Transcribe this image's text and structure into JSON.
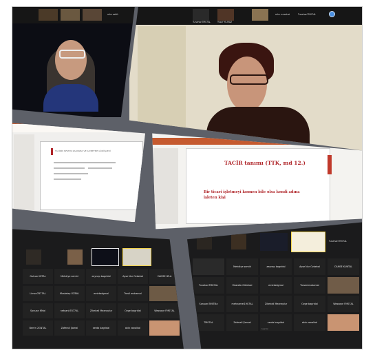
{
  "top_strip_left": {
    "labels": [
      "mhs sahih"
    ]
  },
  "top_strip_right": {
    "labels": [
      "TunahanTM07AL",
      "Yusuf YILMAZ",
      "mhs curoshai",
      "TunahanTM07AL"
    ]
  },
  "slide_right": {
    "title": "TACİR tanımı (TTK, md 12.)",
    "body": "Bir ticari işletmeyi kısmen bile olsa kendi adına işleten kişi"
  },
  "slide_left": {
    "heading": "TACİRİN SIFATINI KAZANMA VE KAYBETME GÖRÜŞLERİ"
  },
  "grid_left": {
    "rows": [
      [
        "Gulcan KETAL",
        "Mehdiye semiri",
        "zeynep bagridal",
        "Ayse Nur Ozbekal",
        "CAMSE IZLA"
      ],
      [
        "Limon7877AL",
        "Mustelep OZBAL",
        "emirtadgmal",
        "Trasil mokamal",
        ""
      ],
      [
        "Sonuan KMal",
        "netyanlı7877AL",
        "Zikeirali Mezneplur",
        "Özge bagridal",
        "Wassaye FM07AL"
      ],
      [
        "Berrin 2GNTAL",
        "Zaferali Şamal",
        "serda bagridal",
        "akin zanalkal",
        ""
      ]
    ]
  },
  "grid_right": {
    "rows": [
      [
        "",
        "",
        "",
        "",
        "TunahanTM07AL"
      ],
      [
        "",
        "Mehdiye semiri",
        "zeynep bagridal",
        "Ayse Nur Ozbekal",
        "CAMSE KUNTAL"
      ],
      [
        "TunahanTM07AL",
        "Mustafa Gülmbal",
        "emirtadgmal",
        "Trasenimokamal",
        ""
      ],
      [
        "Sonuan BMiTilla",
        "mehnamei1907AL",
        "Zikeirali Mezneplur",
        "Özge bagridal",
        "Wassaye FM07AL"
      ],
      [
        "TM07AL",
        "Zaferali Şensal",
        "serda bagridal",
        "akin zanalkal",
        ""
      ]
    ],
    "sub": "bagridal"
  },
  "colors": {
    "frame": "#5d6068",
    "strip": "#161616",
    "slide_title": "#b0262a",
    "accent": "#4a8fe0"
  }
}
